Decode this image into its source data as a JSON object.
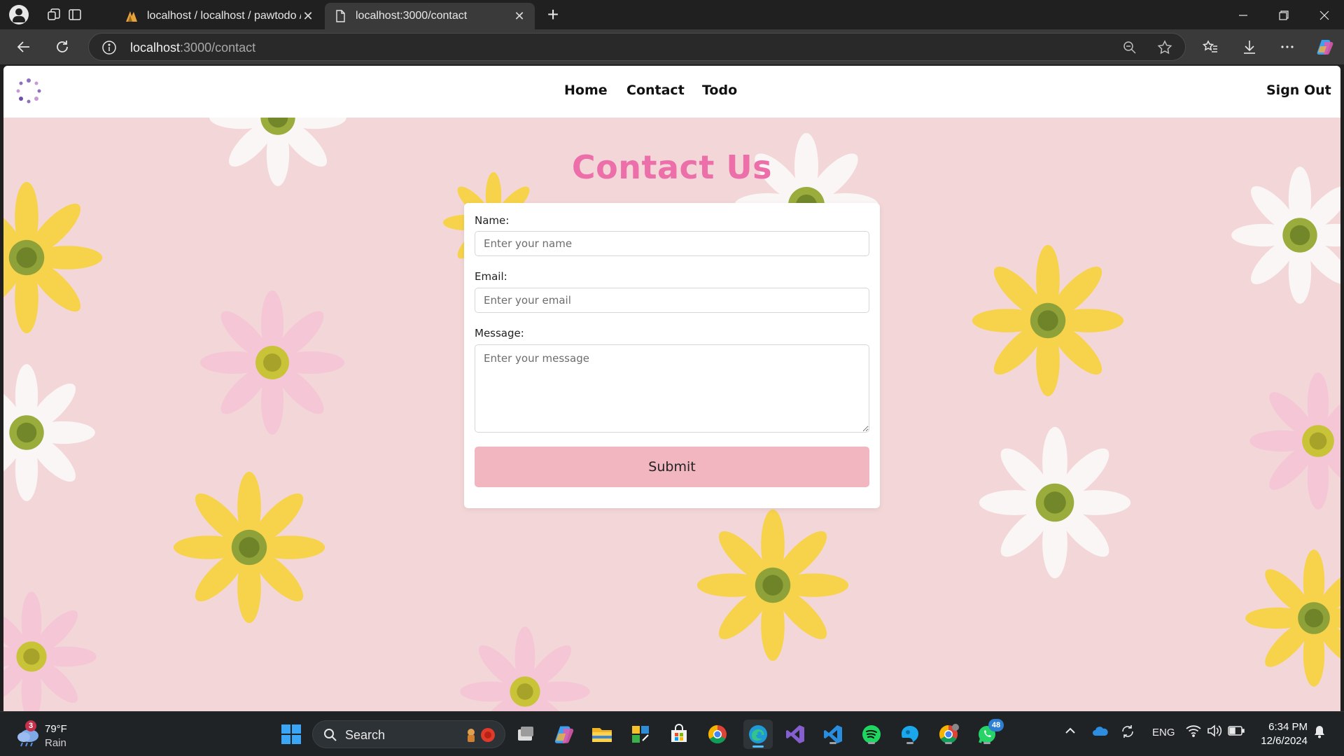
{
  "browser": {
    "tabs": [
      {
        "title": "localhost / localhost / pawtodo / ",
        "active": false
      },
      {
        "title": "localhost:3000/contact",
        "active": true
      }
    ],
    "url_host": "localhost",
    "url_path": ":3000/contact"
  },
  "site": {
    "nav": {
      "links": [
        "Home",
        "Contact",
        "Todo"
      ],
      "sign_out": "Sign Out"
    },
    "heading": "Contact Us",
    "form": {
      "name_label": "Name:",
      "name_placeholder": "Enter your name",
      "email_label": "Email:",
      "email_placeholder": "Enter your email",
      "message_label": "Message:",
      "message_placeholder": "Enter your message",
      "submit_label": "Submit"
    },
    "colors": {
      "heading": "#ec6fa9",
      "submit_bg": "#f1b6c0",
      "background": "#f3d6d8"
    }
  },
  "taskbar": {
    "weather": {
      "temp": "79°F",
      "condition": "Rain",
      "alert_count": "3"
    },
    "search_label": "Search",
    "tray": {
      "language": "ENG"
    },
    "clock": {
      "time": "6:34 PM",
      "date": "12/6/2024"
    },
    "whatsapp_badge": "48",
    "apps": [
      "start-icon",
      "search",
      "task-view-icon",
      "copilot-icon",
      "file-explorer-icon",
      "app-icon",
      "store-icon",
      "chrome-icon",
      "edge-icon",
      "visual-studio-icon",
      "vscode-icon",
      "spotify-icon",
      "app-icon",
      "chrome-icon",
      "whatsapp-icon"
    ]
  }
}
